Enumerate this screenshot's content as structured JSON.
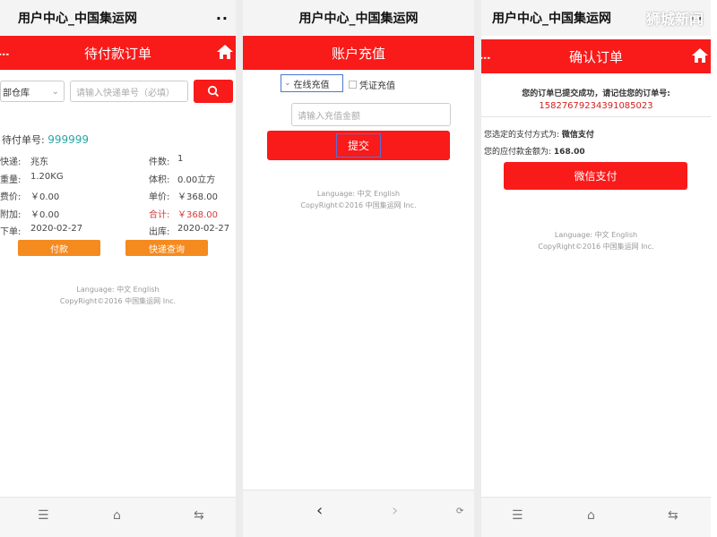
{
  "panel1": {
    "topbar_title": "用户中心_中国集运网",
    "topbar_dots": "··",
    "header_title": "待付款订单",
    "warehouse_select": "部仓库",
    "tracking_placeholder": "请输入快递单号（必填）",
    "order_label": "待付单号:",
    "order_number": "999999",
    "rows": [
      {
        "left_label": "快递:",
        "left_value": "兆东",
        "right_label": "件数:",
        "right_value": "1"
      },
      {
        "left_label": "重量:",
        "left_value": "1.20KG",
        "right_label": "体积:",
        "right_value": "0.00立方"
      },
      {
        "left_label": "费价:",
        "left_value": "￥0.00",
        "right_label": "单价:",
        "right_value": "￥368.00"
      },
      {
        "left_label": "附加:",
        "left_value": "￥0.00",
        "right_label": "合计:",
        "right_value": "￥368.00"
      },
      {
        "left_label": "下单:",
        "left_value": "2020-02-27",
        "right_label": "出库:",
        "right_value": "2020-02-27"
      }
    ],
    "pay_button": "付款",
    "query_button": "快递查询",
    "footer_language": "Language:  中文  English",
    "footer_copyright": "CopyRight©2016 中国集运网 Inc."
  },
  "panel2": {
    "topbar_title": "用户中心_中国集运网",
    "header_title": "账户充值",
    "option_online": "在线充值",
    "option_voucher": "凭证充值",
    "amount_placeholder": "请输入充值金额",
    "submit_button": "提交",
    "footer_language": "Language:  中文  English",
    "footer_copyright": "CopyRight©2016 中国集运网 Inc."
  },
  "panel3": {
    "topbar_title": "用户中心_中国集运网",
    "topbar_dots": "··",
    "header_title": "确认订单",
    "success_text": "您的订单已提交成功，请记住您的订单号:",
    "order_number": "15827679234391085023",
    "pay_method_label": "您选定的支付方式为:",
    "pay_method_value": "微信支付",
    "amount_label": "您的应付款金额为:",
    "amount_value": "168.00",
    "wechat_pay_button": "微信支付",
    "footer_language": "Language:  中文  English",
    "footer_copyright": "CopyRight©2016 中国集运网 Inc."
  },
  "watermark": "狮城新闻",
  "colors": {
    "header_red": "#f91a1a",
    "button_orange": "#f58a1f",
    "order_teal": "#2aa6a6",
    "total_red": "#d43a3a"
  }
}
